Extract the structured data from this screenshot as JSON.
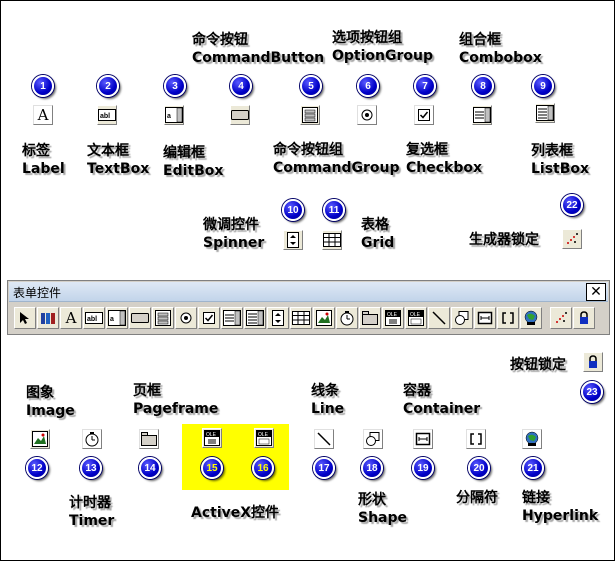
{
  "labels": {
    "l1": [
      "标签",
      "Label"
    ],
    "l2": [
      "文本框",
      "TextBox"
    ],
    "l3": [
      "编辑框",
      "EditBox"
    ],
    "l4": [
      "命令按钮",
      "CommandButton"
    ],
    "l5": [
      "命令按钮组",
      "CommandGroup"
    ],
    "l6": [
      "选项按钮组",
      "OptionGroup"
    ],
    "l7": [
      "复选框",
      "Checkbox"
    ],
    "l8": [
      "组合框",
      "Combobox"
    ],
    "l9": [
      "列表框",
      "ListBox"
    ],
    "l10": [
      "微调控件",
      "Spinner"
    ],
    "l11": [
      "表格",
      "Grid"
    ],
    "l22": [
      "生成器锁定"
    ],
    "l12": [
      "图象",
      "Image"
    ],
    "l13": [
      "计时器",
      "Timer"
    ],
    "l14": [
      "页框",
      "Pageframe"
    ],
    "l1516": [
      "ActiveX控件"
    ],
    "l17": [
      "线条",
      "Line"
    ],
    "l18": [
      "形状",
      "Shape"
    ],
    "l19": [
      "容器",
      "Container"
    ],
    "l20": [
      "分隔符"
    ],
    "l21": [
      "链接",
      "Hyperlink"
    ],
    "l23": [
      "按钮锁定"
    ]
  },
  "badges": [
    "1",
    "2",
    "3",
    "4",
    "5",
    "6",
    "7",
    "8",
    "9",
    "10",
    "11",
    "12",
    "13",
    "14",
    "15",
    "16",
    "17",
    "18",
    "19",
    "20",
    "21",
    "22",
    "23"
  ],
  "toolbar": {
    "title": "表单控件",
    "close_glyph": "✕"
  },
  "icons": {
    "label_glyph": "A",
    "textbox_glyph": "abl",
    "olecontrol_glyph": "OLE"
  },
  "colors": {
    "badge": "#0000c8",
    "highlight": "#ffff00",
    "toolbar_bg": "#d4d0c8"
  }
}
